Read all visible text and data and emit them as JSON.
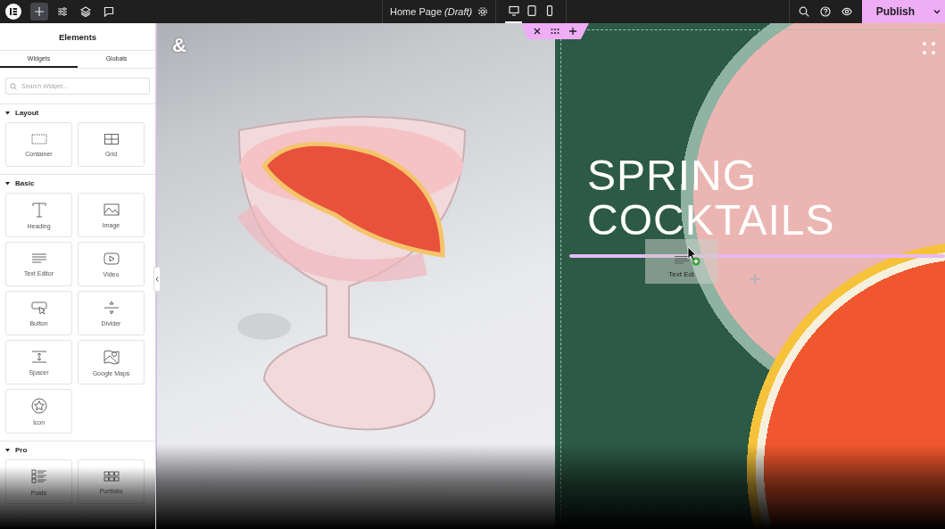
{
  "topbar": {
    "tools": [
      {
        "kind": "add",
        "selected": true
      },
      {
        "kind": "settings",
        "selected": false
      },
      {
        "kind": "layers",
        "selected": false
      },
      {
        "kind": "comments",
        "selected": false
      }
    ],
    "page_title": "Home Page",
    "page_status": "(Draft)",
    "devices": [
      {
        "kind": "desktop",
        "selected": true
      },
      {
        "kind": "tablet",
        "selected": false
      },
      {
        "kind": "mobile",
        "selected": false
      }
    ],
    "publish": "Publish"
  },
  "panel": {
    "title": "Elements",
    "tabs": [
      {
        "label": "Widgets",
        "selected": true
      },
      {
        "label": "Globals",
        "selected": false
      }
    ],
    "search": {
      "placeholder": "Search Widget..."
    },
    "sections": [
      {
        "title": "Layout",
        "expanded": true,
        "widgets": [
          {
            "label": "Container",
            "kind": "container"
          },
          {
            "label": "Grid",
            "kind": "grid"
          }
        ]
      },
      {
        "title": "Basic",
        "expanded": true,
        "widgets": [
          {
            "label": "Heading",
            "kind": "heading"
          },
          {
            "label": "Image",
            "kind": "image"
          },
          {
            "label": "Text Editor",
            "kind": "text"
          },
          {
            "label": "Video",
            "kind": "video"
          },
          {
            "label": "Button",
            "kind": "button"
          },
          {
            "label": "Divider",
            "kind": "divider"
          },
          {
            "label": "Spacer",
            "kind": "spacer"
          },
          {
            "label": "Google Maps",
            "kind": "map"
          },
          {
            "label": "Icon",
            "kind": "icon"
          }
        ]
      },
      {
        "title": "Pro",
        "expanded": true,
        "widgets": [
          {
            "label": "Posts",
            "kind": "posts"
          },
          {
            "label": "Portfolio",
            "kind": "portfolio"
          }
        ]
      }
    ]
  },
  "canvas": {
    "logo": "&",
    "heading": "SPRING COCKTAILS",
    "drag_ghost": {
      "label": "Text Edi"
    }
  }
}
